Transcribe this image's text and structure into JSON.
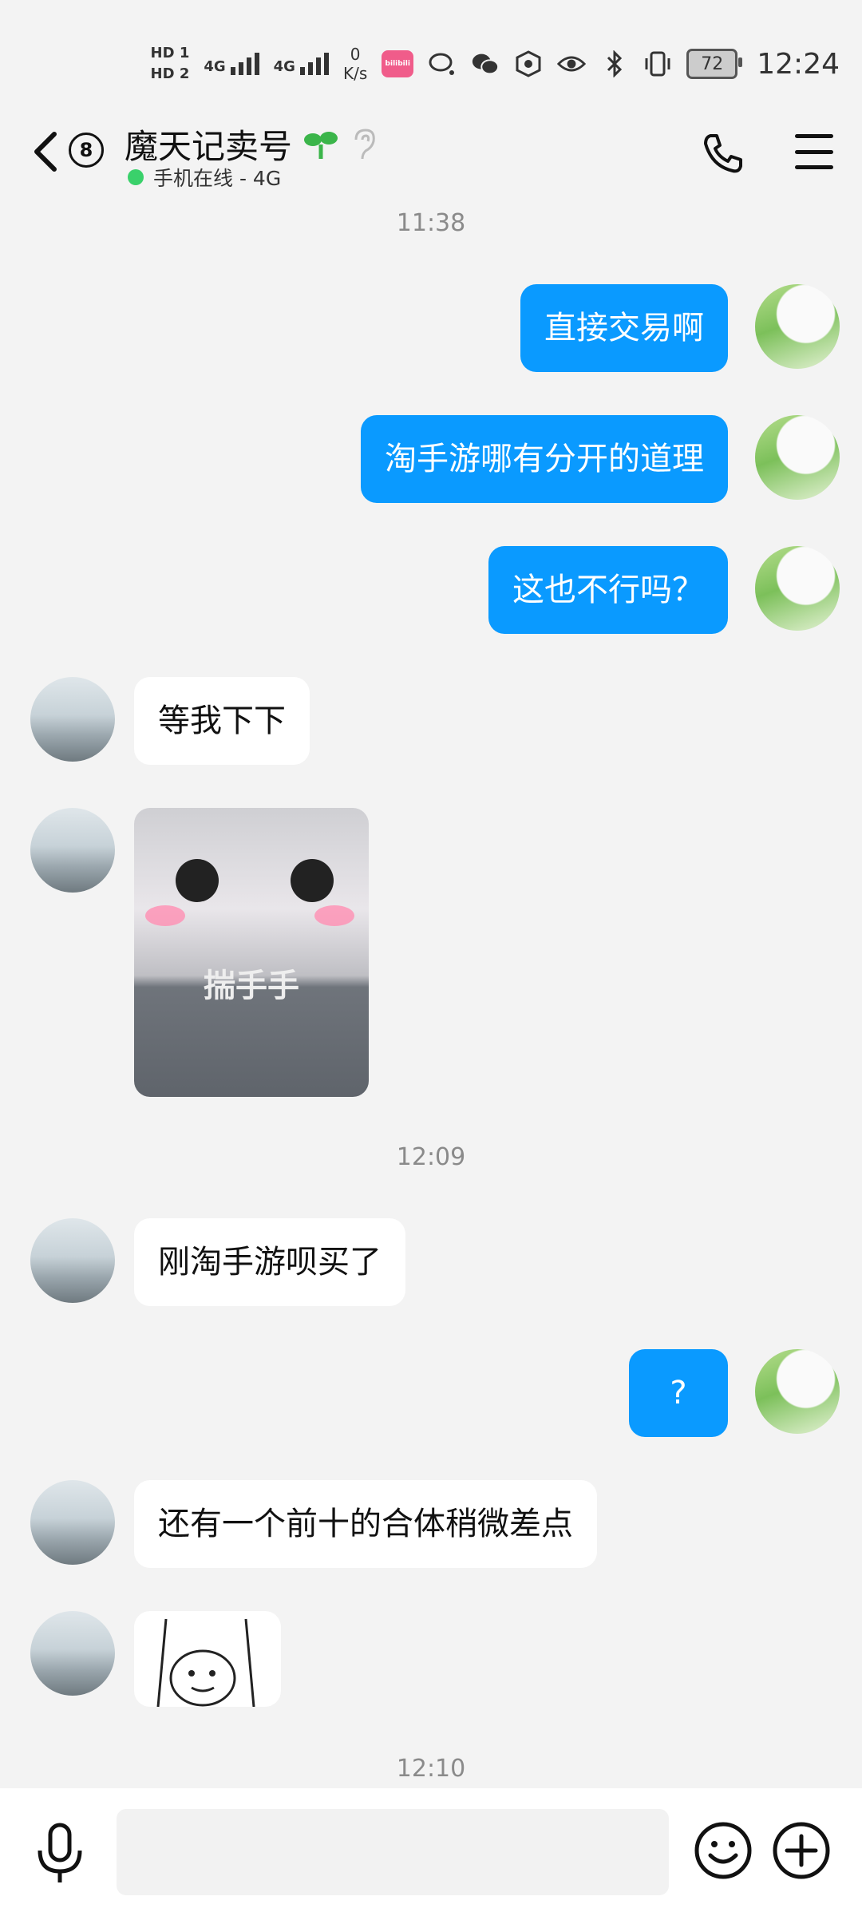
{
  "status_bar": {
    "hd1": "HD 1",
    "hd2": "HD 2",
    "net1": "4G",
    "net2": "4G",
    "net_speed_value": "0",
    "net_speed_unit": "K/s",
    "bili_label": "bilibili",
    "battery_level": "72",
    "time": "12:24"
  },
  "header": {
    "badge_count": "8",
    "title": "魔天记卖号",
    "status_text": "手机在线 - 4G"
  },
  "messages": {
    "time1": "11:38",
    "out1": "直接交易啊",
    "out2": "淘手游哪有分开的道理",
    "out3": "这也不行吗？",
    "in1": "等我下下",
    "sticker1_caption": "揣手手",
    "time2": "12:09",
    "in2": "刚淘手游呗买了",
    "out4": "?",
    "in3": "还有一个前十的合体稍微差点",
    "time3": "12:10"
  },
  "input": {
    "placeholder": ""
  },
  "colors": {
    "outgoing_bubble": "#0a9aff",
    "incoming_bubble": "#ffffff",
    "background": "#f3f3f3",
    "online": "#3ad16b"
  }
}
